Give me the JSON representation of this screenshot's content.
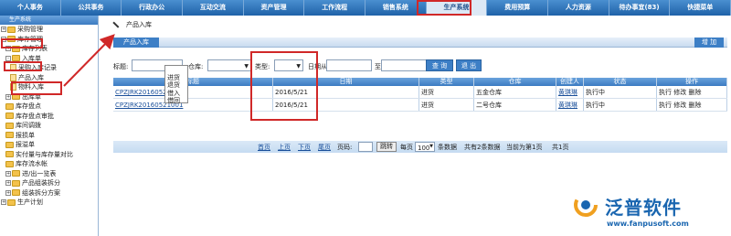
{
  "topnav": [
    "个人事务",
    "公共事务",
    "行政办公",
    "互动交流",
    "资产管理",
    "工作流程",
    "销售系统",
    "生产系统",
    "费用预算",
    "人力资源",
    "待办事宜(83)",
    "快捷菜单"
  ],
  "sidebar": {
    "title": "生产系统",
    "items": [
      {
        "label": "采购管理",
        "level": 0,
        "pm": "+"
      },
      {
        "label": "库存管理",
        "level": 0,
        "pm": "-"
      },
      {
        "label": "库存列表",
        "level": 1,
        "pm": "+"
      },
      {
        "label": "入库单",
        "level": 1,
        "pm": "-"
      },
      {
        "label": "采购入库记录",
        "level": 2,
        "pm": ""
      },
      {
        "label": "产品入库",
        "level": 2,
        "pm": ""
      },
      {
        "label": "物料入库",
        "level": 2,
        "pm": ""
      },
      {
        "label": "出库单",
        "level": 1,
        "pm": "+"
      },
      {
        "label": "库存盘点",
        "level": 1,
        "pm": ""
      },
      {
        "label": "库存盘点审批",
        "level": 1,
        "pm": ""
      },
      {
        "label": "库间调拨",
        "level": 1,
        "pm": ""
      },
      {
        "label": "报损单",
        "level": 1,
        "pm": ""
      },
      {
        "label": "报溢单",
        "level": 1,
        "pm": ""
      },
      {
        "label": "实付量与库存量对比",
        "level": 1,
        "pm": ""
      },
      {
        "label": "库存流水帐",
        "level": 1,
        "pm": ""
      },
      {
        "label": "进/出一览表",
        "level": 1,
        "pm": "+"
      },
      {
        "label": "产品组装拆分",
        "level": 1,
        "pm": "+"
      },
      {
        "label": "组装拆分方案",
        "level": 1,
        "pm": "+"
      },
      {
        "label": "生产计划",
        "level": 0,
        "pm": "+"
      }
    ]
  },
  "breadcrumb": "产品入库",
  "tab_label": "产品入库",
  "add_label": "增 加",
  "filters": {
    "title_label": "标题:",
    "warehouse_label": "仓库:",
    "type_label": "类型:",
    "date_from_label": "日期从",
    "date_to_label": "至",
    "search_label": "查 询",
    "exit_label": "退 出"
  },
  "type_options": [
    "",
    "进货",
    "退货",
    "借入",
    "借回"
  ],
  "table": {
    "headers": [
      "标题",
      "日期",
      "类型",
      "仓库",
      "创建人",
      "状态",
      "操作"
    ],
    "rows": [
      {
        "title": "CPZJRK20160521002",
        "date": "2016/5/21",
        "type": "进货",
        "warehouse": "五金仓库",
        "creator": "黄琪琳",
        "status": "执行中",
        "actions": "执行 修改 删除"
      },
      {
        "title": "CPZJRK20160521001",
        "date": "2016/5/21",
        "type": "进货",
        "warehouse": "二号仓库",
        "creator": "黄琪琳",
        "status": "执行中",
        "actions": "执行 修改 删除"
      }
    ]
  },
  "pager": {
    "first": "首页",
    "prev": "上页",
    "next": "下页",
    "last": "尾页",
    "page_code": "页码:",
    "go": "跳转",
    "per_page": "每页",
    "per_page_value": "100",
    "records": "条数据",
    "total": "共有2条数据",
    "current": "当前为第1页",
    "pages": "共1页"
  },
  "logo": {
    "name": "泛普软件",
    "url": "www.fanpusoft.com"
  },
  "colors": {
    "nav": "#1f62a8",
    "highlight": "#d02828",
    "accent": "#3d7fc6"
  }
}
